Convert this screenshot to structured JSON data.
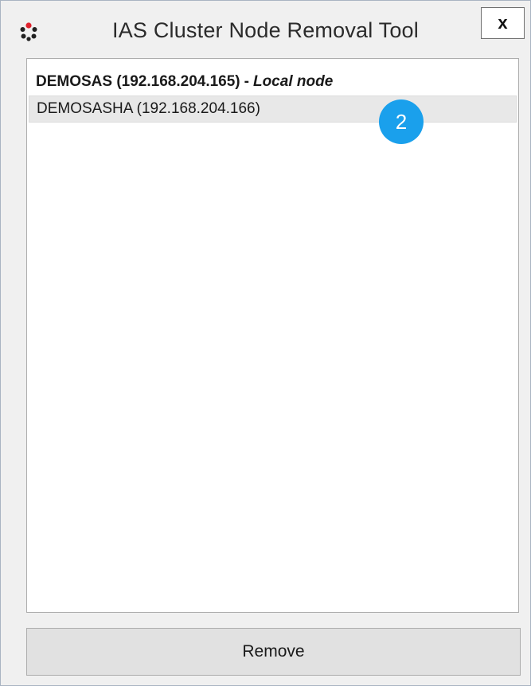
{
  "window": {
    "title": "IAS Cluster Node Removal Tool",
    "close_label": "x",
    "app_icon": "cluster-dots-icon"
  },
  "nodes": [
    {
      "name_ip": "DEMOSAS (192.168.204.165)",
      "separator": "-",
      "tag": "Local node",
      "is_local": true,
      "selected": false
    },
    {
      "name_ip": "DEMOSASHA (192.168.204.166)",
      "is_local": false,
      "selected": true
    }
  ],
  "annotation": {
    "step_number": "2",
    "color": "#1aa0ec"
  },
  "actions": {
    "remove_label": "Remove"
  },
  "colors": {
    "window_bg": "#f0f0f0",
    "list_bg": "#ffffff",
    "selection_bg": "#e8e8e8",
    "icon_red": "#e0232e",
    "icon_dark": "#222222"
  }
}
